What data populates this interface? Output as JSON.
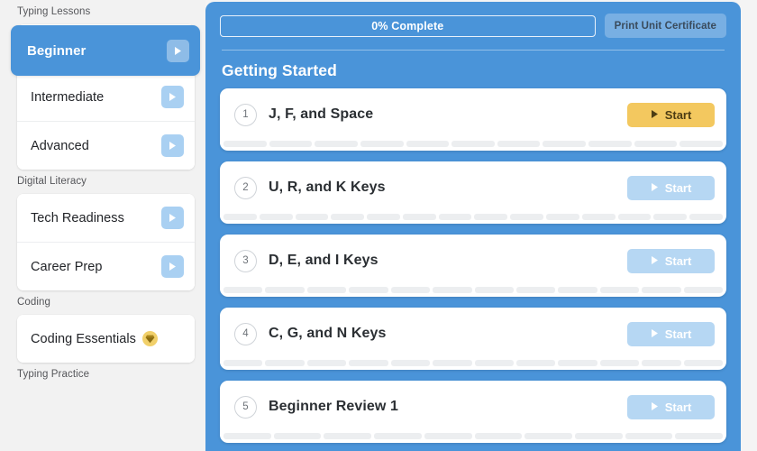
{
  "sidebar": {
    "sections": [
      {
        "heading": "Typing Lessons",
        "items": [
          {
            "label": "Beginner",
            "active": true,
            "play_icon": "play-triangle-icon"
          },
          {
            "label": "Intermediate",
            "active": false,
            "play_icon": "play-triangle-icon"
          },
          {
            "label": "Advanced",
            "active": false,
            "play_icon": "play-triangle-icon"
          }
        ]
      },
      {
        "heading": "Digital Literacy",
        "items": [
          {
            "label": "Tech Readiness",
            "active": false,
            "play_icon": "play-triangle-icon"
          },
          {
            "label": "Career Prep",
            "active": false,
            "play_icon": "play-triangle-icon"
          }
        ]
      },
      {
        "heading": "Coding",
        "items": [
          {
            "label": "Coding Essentials",
            "active": false,
            "badge_icon": "gem-icon",
            "badge_glyph": "◆"
          }
        ]
      },
      {
        "heading": "Typing Practice",
        "items": []
      }
    ]
  },
  "main": {
    "progress": {
      "label": "0% Complete",
      "percent": 0
    },
    "certificate_button": "Print Unit Certificate",
    "section_title": "Getting Started",
    "lessons": [
      {
        "number": "1",
        "title": "J, F, and Space",
        "start_label": "Start",
        "enabled": true,
        "segments": 11
      },
      {
        "number": "2",
        "title": "U, R, and K Keys",
        "start_label": "Start",
        "enabled": false,
        "segments": 14
      },
      {
        "number": "3",
        "title": "D, E, and I Keys",
        "start_label": "Start",
        "enabled": false,
        "segments": 12
      },
      {
        "number": "4",
        "title": "C, G, and N Keys",
        "start_label": "Start",
        "enabled": false,
        "segments": 12
      },
      {
        "number": "5",
        "title": "Beginner Review 1",
        "start_label": "Start",
        "enabled": false,
        "segments": 10
      }
    ]
  },
  "colors": {
    "panel_blue": "#4a94d9",
    "start_active": "#f3c85f",
    "start_disabled": "#b6d7f3",
    "sidebar_bg": "#f2f2f2",
    "card_bg": "#ffffff",
    "gem_gold": "#f1d06a"
  }
}
